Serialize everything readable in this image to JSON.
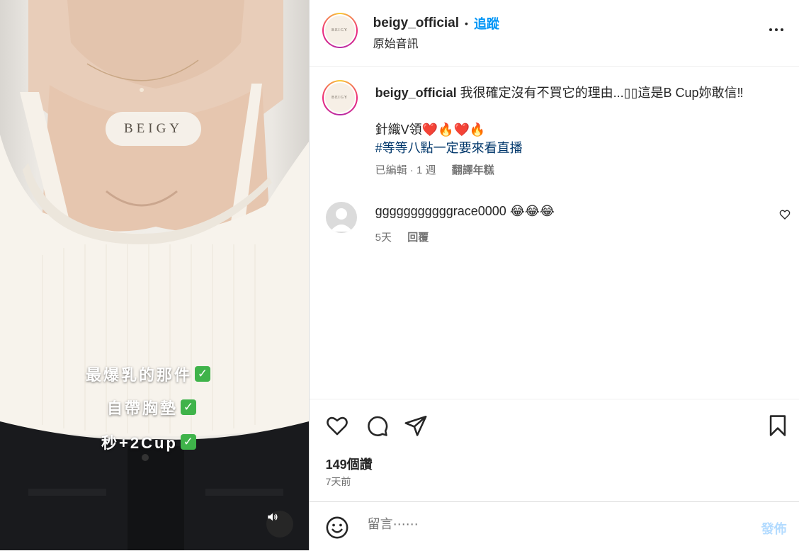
{
  "media": {
    "brand": "BEIGY",
    "overlay_lines": [
      "最爆乳的那件",
      "自帶胸墊",
      "秒+2Cup"
    ],
    "check_glyph": "✓",
    "sound_icon": "speaker-icon"
  },
  "header": {
    "username": "beigy_official",
    "dot": "•",
    "follow_label": "追蹤",
    "audio_label": "原始音訊",
    "avatar_text": "BEIGY",
    "more_icon": "more-options-icon"
  },
  "caption": {
    "username": "beigy_official",
    "text": "我很確定沒有不買它的理由...▯▯這是B Cup妳敢信‼",
    "line2": "針織V領❤️🔥❤️🔥",
    "hashtag": "#等等八點一定要來看直播",
    "edited_meta": "已編輯 · 1 週",
    "translate_label": "翻譯年糕"
  },
  "comment": {
    "username": "gggggggggggrace0000",
    "text": "😂😂😂",
    "time": "5天",
    "reply_label": "回覆"
  },
  "actions": {
    "likes": "149個讚",
    "posted": "7天前"
  },
  "composer": {
    "placeholder": "留言⋯⋯",
    "post_label": "發佈"
  },
  "colors": {
    "accent": "#0095f6",
    "hashtag": "#00376b",
    "muted": "#737373",
    "post_disabled": "#b3dbff"
  }
}
